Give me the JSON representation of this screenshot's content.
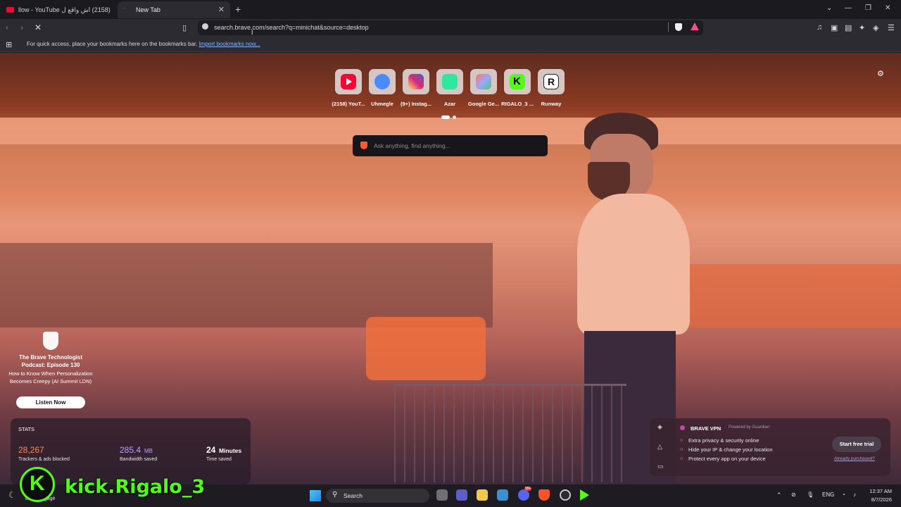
{
  "tabs": [
    {
      "title": "(2158) اش واقع ل llow - YouTube",
      "active": false
    },
    {
      "title": "New Tab",
      "active": true
    }
  ],
  "toolbar": {
    "url": "search.brave.com/search?q=minichat&source=desktop"
  },
  "bookmarks_bar": {
    "hint": "For quick access, place your bookmarks here on the bookmarks bar.",
    "import_link": "Import bookmarks now..."
  },
  "shortcuts": [
    {
      "label": "(2158) YouT...",
      "icon": "youtube-icon",
      "color": "#ff0033"
    },
    {
      "label": "Uhmegle",
      "icon": "chat-bubble-icon",
      "color": "#4a8cff"
    },
    {
      "label": "(9+) Instag...",
      "icon": "instagram-icon",
      "color": "#d6249f"
    },
    {
      "label": "Azar",
      "icon": "azar-icon",
      "color": "#2ee8a0"
    },
    {
      "label": "Google Ge...",
      "icon": "gemini-icon",
      "color": "#9aa7ff"
    },
    {
      "label": "RIGALO_3 ...",
      "icon": "kick-icon",
      "color": "#53fc18"
    },
    {
      "label": "Runway",
      "icon": "runway-icon",
      "color": "#111111"
    }
  ],
  "search": {
    "placeholder": "Ask anything, find anything..."
  },
  "promo": {
    "title": "The Brave Technologist Podcast: Episode 130",
    "subtitle": "How to Know When Personalization Becomes Creepy (AI Summit LDN)",
    "button": "Listen Now"
  },
  "stats": {
    "heading": "STATS",
    "trackers_value": "28,267",
    "trackers_label": "Trackers & ads blocked",
    "bandwidth_value": "285.4",
    "bandwidth_unit": "MB",
    "bandwidth_label": "Bandwidth saved",
    "time_value": "24",
    "time_unit": "Minutes",
    "time_label": "Time saved",
    "colors": {
      "trackers": "#ff8a5c",
      "bandwidth": "#b9a6ff",
      "time": "#ffffff"
    }
  },
  "vpn": {
    "title": "BRAVE VPN",
    "powered": "Powered by Guardian",
    "features": [
      "Extra privacy & security online",
      "Hide your IP & change your location",
      "Protect every app on your device"
    ],
    "trial_button": "Start free trial",
    "purchased_link": "Already purchased?"
  },
  "taskbar": {
    "search_placeholder": "Search",
    "weather_label": "emps dégagé",
    "lang": "ENG",
    "time": "12:37 AM",
    "date": "8/7/2026",
    "badge": "99+"
  },
  "overlay": {
    "kick_name": "kick.Rigalo_3"
  }
}
